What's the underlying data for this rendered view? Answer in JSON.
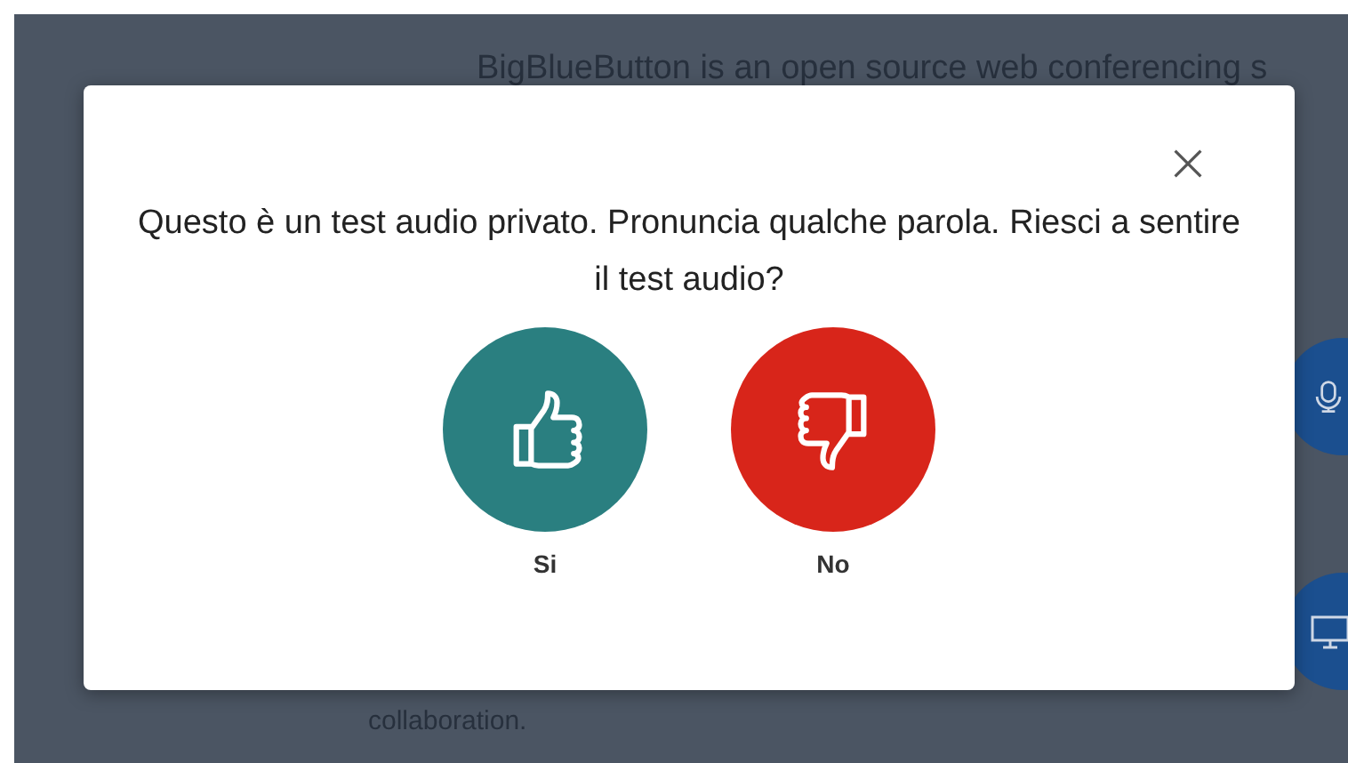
{
  "background": {
    "intro_text": "BigBlueButton is an open source web conferencing s",
    "footer_text": "collaboration."
  },
  "dialog": {
    "message": "Questo è un test audio privato. Pronuncia qualche parola. Riesci a sentire il test audio?",
    "answers": [
      {
        "label": "Si",
        "kind": "yes",
        "color": "#2a7f80"
      },
      {
        "label": "No",
        "kind": "no",
        "color": "#d8251a"
      }
    ]
  }
}
